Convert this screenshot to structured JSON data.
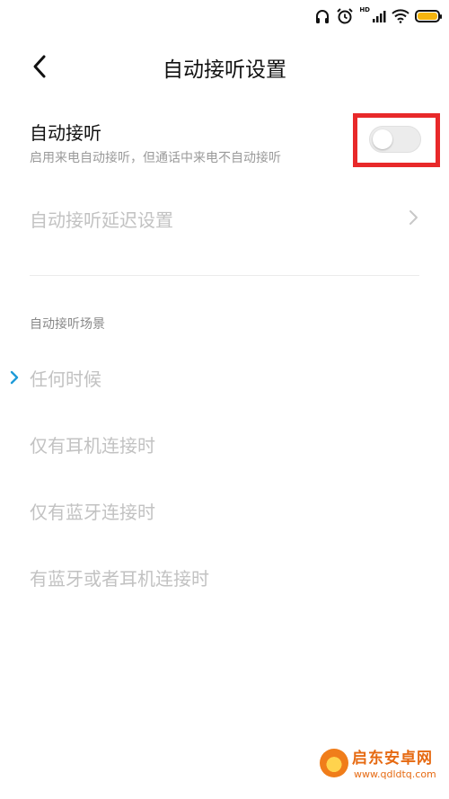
{
  "status_bar": {
    "icons": [
      "headphones-icon",
      "alarm-icon",
      "hd-signal-icon",
      "wifi-icon",
      "battery-icon"
    ],
    "hd_label": "HD",
    "battery_color": "#f5b50f"
  },
  "header": {
    "back_icon": "chevron-left-icon",
    "title": "自动接听设置"
  },
  "auto_answer": {
    "title": "自动接听",
    "description": "启用来电自动接听，但通话中来电不自动接听",
    "enabled": false,
    "highlight_color": "#e8292a"
  },
  "delay_setting": {
    "label": "自动接听延迟设置",
    "chevron_icon": "chevron-right-icon"
  },
  "scenes": {
    "section_title": "自动接听场景",
    "selected_index": 0,
    "accent_color": "#1f9bd8",
    "items": [
      {
        "label": "任何时候"
      },
      {
        "label": "仅有耳机连接时"
      },
      {
        "label": "仅有蓝牙连接时"
      },
      {
        "label": "有蓝牙或者耳机连接时"
      }
    ]
  },
  "watermark": {
    "name": "启东安卓网",
    "url": "www.qdldtq.com"
  }
}
